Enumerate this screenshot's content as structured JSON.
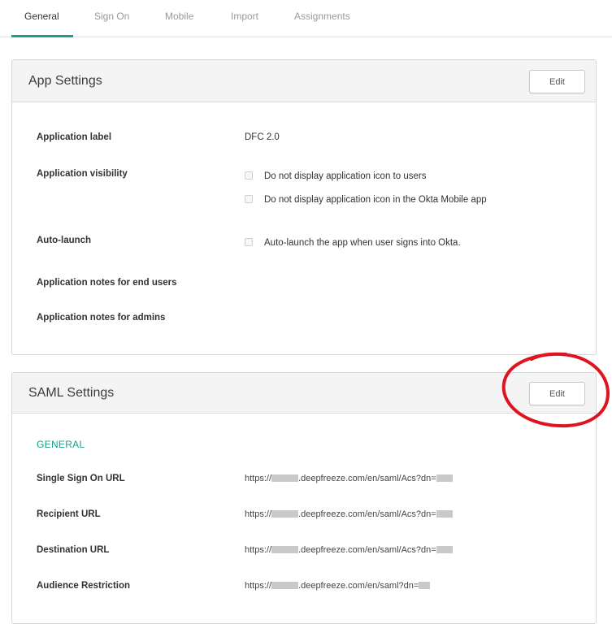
{
  "tabs": [
    {
      "label": "General",
      "active": true
    },
    {
      "label": "Sign On",
      "active": false
    },
    {
      "label": "Mobile",
      "active": false
    },
    {
      "label": "Import",
      "active": false
    },
    {
      "label": "Assignments",
      "active": false
    }
  ],
  "app_settings": {
    "title": "App Settings",
    "edit_label": "Edit",
    "application_label": {
      "label": "Application label",
      "value": "DFC 2.0"
    },
    "application_visibility": {
      "label": "Application visibility",
      "options": [
        {
          "text": "Do not display application icon to users",
          "checked": false
        },
        {
          "text": "Do not display application icon in the Okta Mobile app",
          "checked": false
        }
      ]
    },
    "auto_launch": {
      "label": "Auto-launch",
      "option": {
        "text": "Auto-launch the app when user signs into Okta.",
        "checked": false
      }
    },
    "notes_end_users": {
      "label": "Application notes for end users",
      "value": ""
    },
    "notes_admins": {
      "label": "Application notes for admins",
      "value": ""
    }
  },
  "saml_settings": {
    "title": "SAML Settings",
    "edit_label": "Edit",
    "section_label": "GENERAL",
    "rows": [
      {
        "label": "Single Sign On URL",
        "prefix": "https://",
        "middle": ".deepfreeze.com/en/saml/Acs?dn="
      },
      {
        "label": "Recipient URL",
        "prefix": "https://",
        "middle": ".deepfreeze.com/en/saml/Acs?dn="
      },
      {
        "label": "Destination URL",
        "prefix": "https://",
        "middle": ".deepfreeze.com/en/saml/Acs?dn="
      },
      {
        "label": "Audience Restriction",
        "prefix": "https://",
        "middle": ".deepfreeze.com/en/saml?dn="
      }
    ]
  },
  "colors": {
    "accent": "#1a9e8f",
    "annotation": "#e0141e"
  }
}
